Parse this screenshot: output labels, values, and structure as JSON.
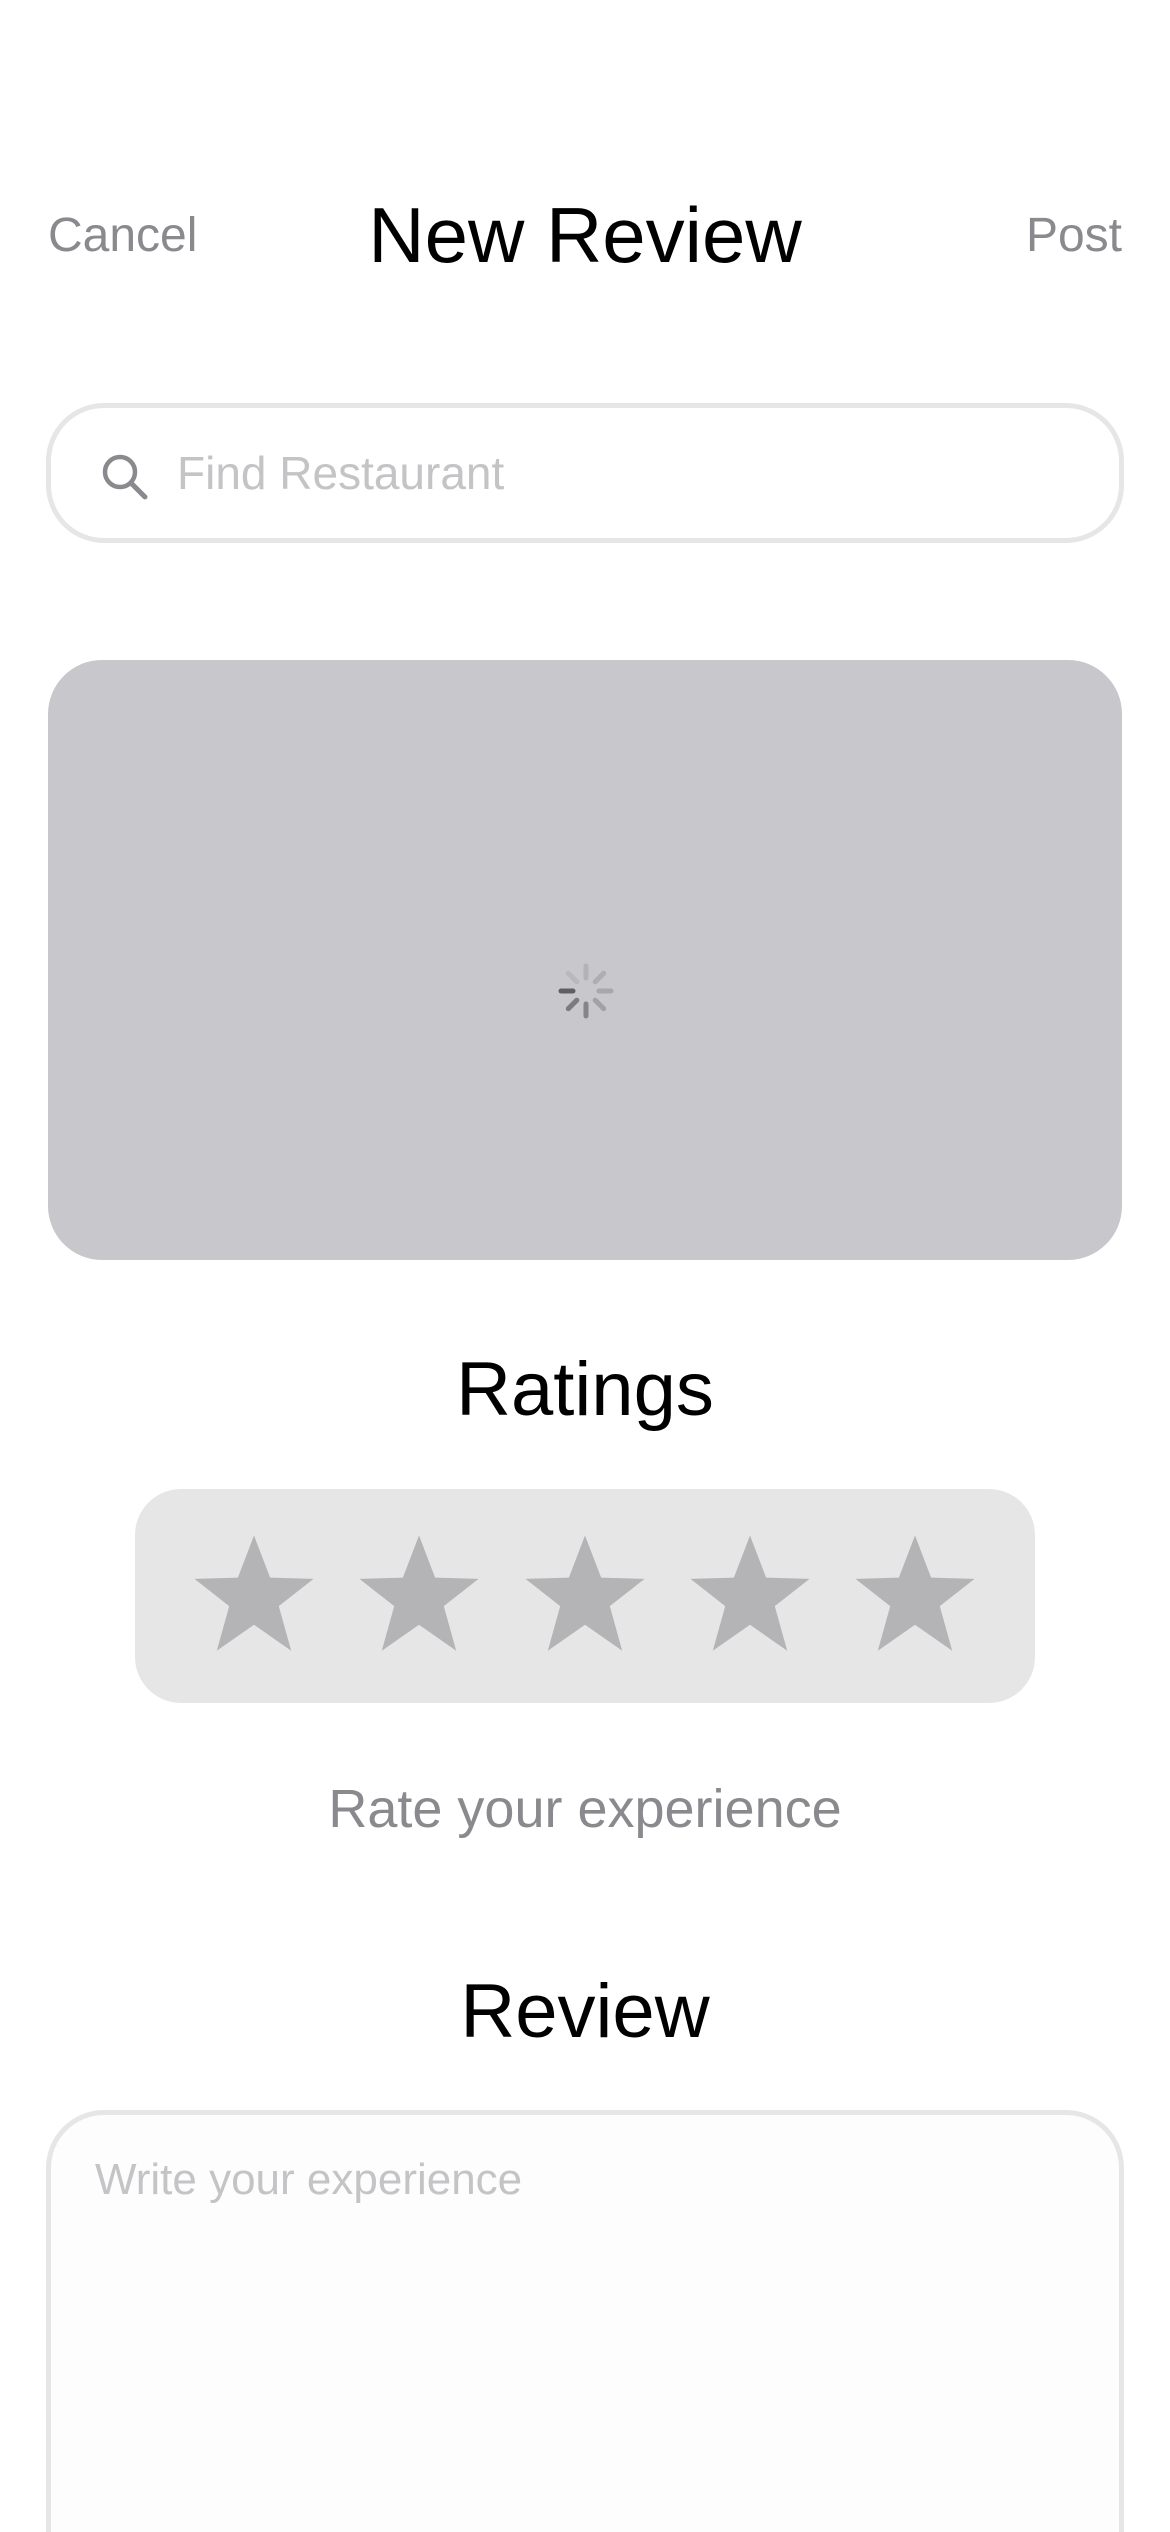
{
  "header": {
    "cancel_label": "Cancel",
    "title": "New Review",
    "post_label": "Post"
  },
  "search": {
    "placeholder": "Find Restaurant",
    "value": "",
    "icon": "search-icon"
  },
  "image_placeholder": {
    "state": "loading",
    "icon": "spinner-icon"
  },
  "ratings": {
    "title": "Ratings",
    "max_stars": 5,
    "selected": 0,
    "star_icon": "star-icon",
    "hint": "Rate your experience"
  },
  "review": {
    "title": "Review",
    "placeholder": "Write your experience",
    "value": ""
  },
  "colors": {
    "secondary_text": "#8a8a8e",
    "placeholder_text": "#c4c4c6",
    "image_placeholder_bg": "#c7c7cc",
    "stars_bg": "#e6e6e7",
    "star_inactive": "#b4b4b6",
    "border": "#e6e6e8"
  }
}
